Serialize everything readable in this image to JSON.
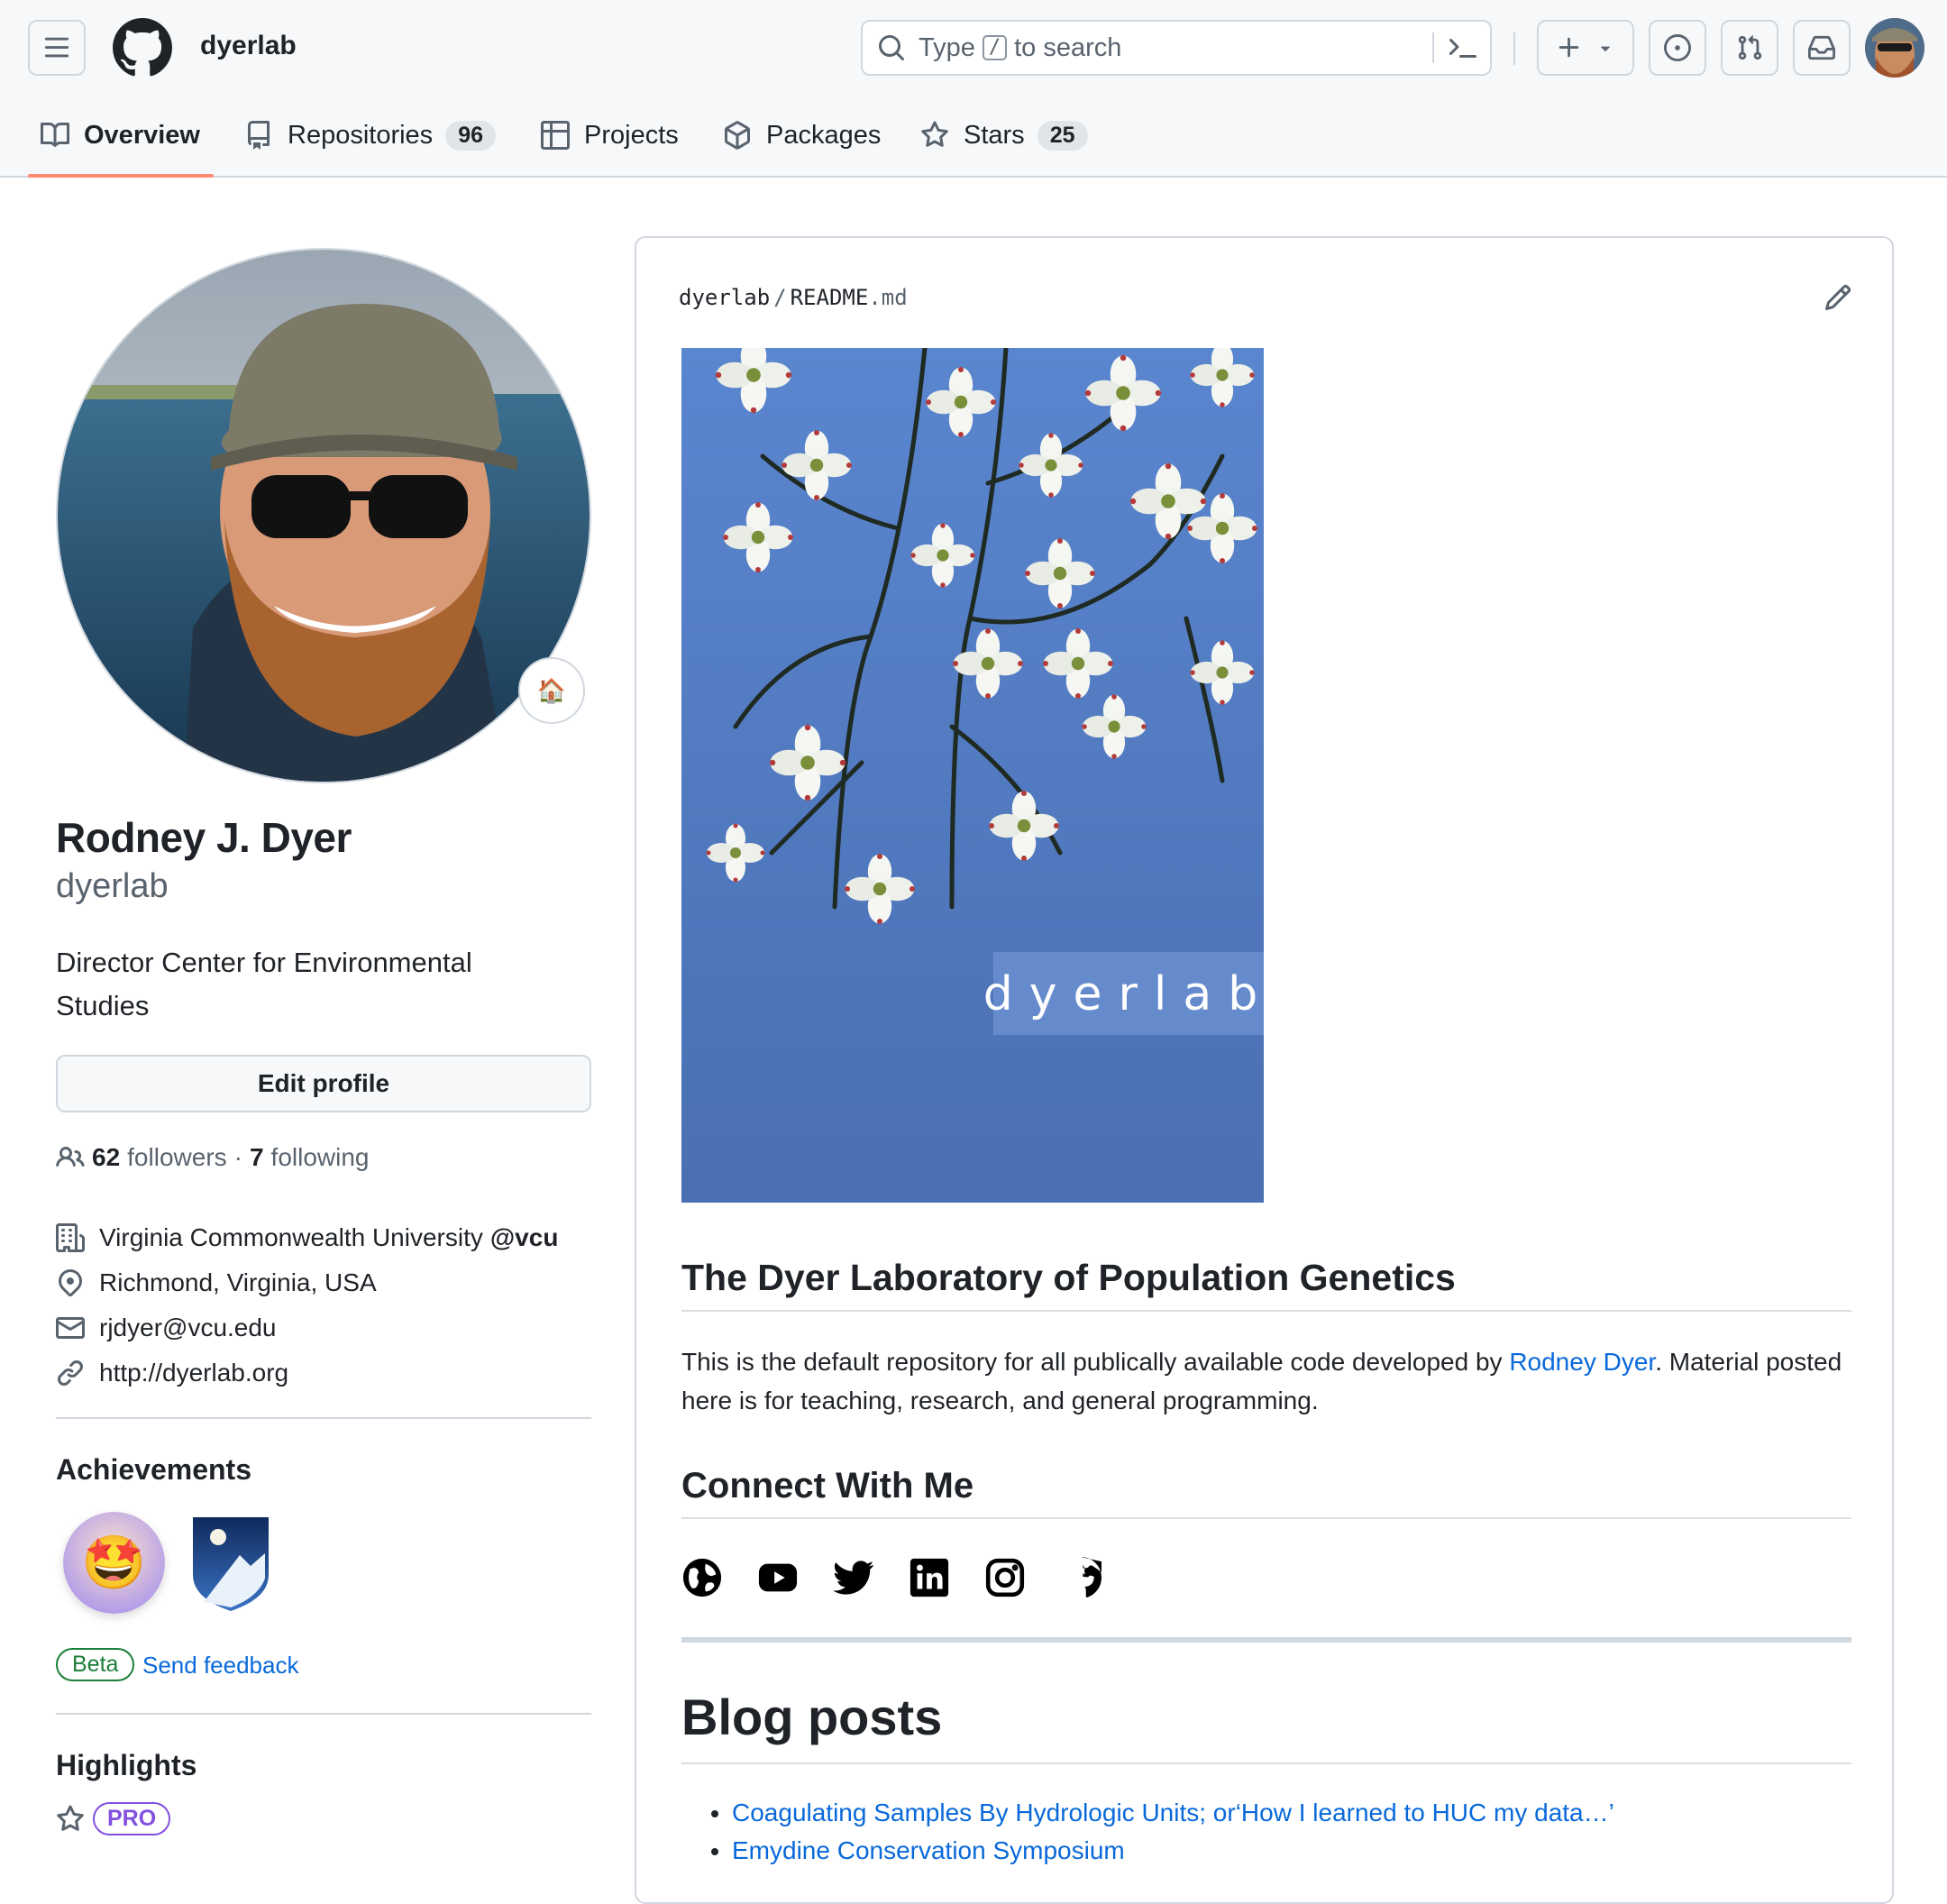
{
  "header": {
    "brand": "dyerlab",
    "search": {
      "prefix": "Type",
      "key": "/",
      "suffix": "to search"
    }
  },
  "nav": {
    "tabs": [
      {
        "label": "Overview",
        "active": true
      },
      {
        "label": "Repositories",
        "count": "96"
      },
      {
        "label": "Projects"
      },
      {
        "label": "Packages"
      },
      {
        "label": "Stars",
        "count": "25"
      }
    ]
  },
  "profile": {
    "status_emoji": "🏠",
    "name": "Rodney J. Dyer",
    "login": "dyerlab",
    "bio": "Director Center for Environmental Studies",
    "edit_label": "Edit profile",
    "followers_count": "62",
    "followers_label": "followers",
    "dot": "·",
    "following_count": "7",
    "following_label": "following",
    "organization": "Virginia Commonwealth University",
    "org_handle": "@vcu",
    "location": "Richmond, Virginia, USA",
    "email": "rjdyer@vcu.edu",
    "website": "http://dyerlab.org"
  },
  "achievements": {
    "title": "Achievements",
    "badge1_emoji": "🤩",
    "beta_label": "Beta",
    "feedback_label": "Send feedback"
  },
  "highlights": {
    "title": "Highlights",
    "pro_label": "PRO"
  },
  "readme": {
    "crumb_owner": "dyerlab",
    "crumb_sep": "/",
    "crumb_file": "README",
    "crumb_ext": ".md",
    "cover_text": "dyerlab",
    "h1": "The Dyer Laboratory of Population Genetics",
    "para_before": "This is the default repository for all publically available code developed by ",
    "para_link": "Rodney Dyer",
    "para_after": ". Material posted here is for teaching, research, and general programming.",
    "connect_title": "Connect With Me",
    "social_icons": [
      "globe-icon",
      "youtube-icon",
      "twitter-icon",
      "linkedin-icon",
      "instagram-icon",
      "github-icon"
    ],
    "blog_title": "Blog posts",
    "posts": [
      "Coagulating Samples By Hydrologic Units; or‘How I learned to HUC my data…’",
      "Emydine Conservation Symposium"
    ]
  },
  "colors": {
    "accent_underline": "#fd8c73",
    "link": "#0969da",
    "beta_green": "#1a7f37",
    "pro_purple": "#8250df"
  }
}
